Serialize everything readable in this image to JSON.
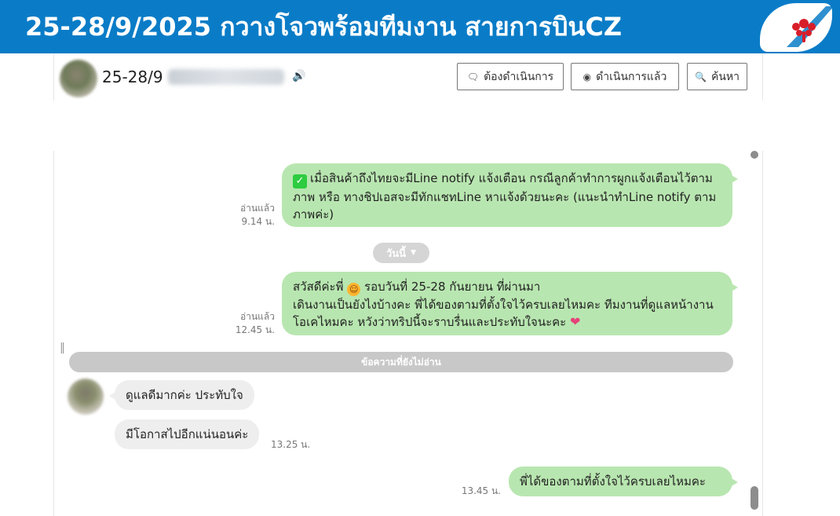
{
  "banner": {
    "title": "25-28/9/2025 กวางโจวพร้อมทีมงาน สายการบินCZ",
    "logo_icon": "airline-logo",
    "colors": {
      "banner_bg": "#0a7cc7",
      "logo_red": "#d81e2a"
    }
  },
  "chat_header": {
    "name_prefix": "25-28/9",
    "speaker_icon": "speaker-icon",
    "buttons": {
      "todo_label": "ต้องดำเนินการ",
      "done_label": "ดำเนินการแล้ว",
      "search_label": "ค้นหา"
    }
  },
  "messages": {
    "m1": {
      "text": "เมื่อสินค้าถึงไทยจะมีLine notify แจ้งเตือน กรณีลูกค้าทำการผูกแจ้งเตือนไว้ตามภาพ หรือ ทางชิปเอสจะมีทักแชทLine หาแจ้งด้วยนะคะ (แนะนำทำLine notify ตามภาพค่ะ)",
      "read": "อ่านแล้ว",
      "time": "9.14 น."
    },
    "date_divider": "วันนี้",
    "m2": {
      "line1": "สวัสดีค่ะพี่",
      "line1b": "รอบวันที่ 25-28 กันยายน ที่ผ่านมา",
      "line2": "เดินงานเป็นยังไงบ้างคะ พี่ได้ของตามที่ตั้งใจไว้ครบเลยไหมคะ ทีมงานที่ดูแลหน้างานโอเคไหมคะ หวังว่าทริปนี้จะราบรื่นและประทับใจนะคะ",
      "read": "อ่านแล้ว",
      "time": "12.45 น."
    },
    "unread_divider": "ข้อความที่ยังไม่อ่าน",
    "in1": {
      "text": "ดูแลดีมากค่ะ ประทับใจ"
    },
    "in2": {
      "text": "มีโอกาสไปอีกแน่นอนค่ะ",
      "time": "13.25 น."
    },
    "m3": {
      "text": "พี่ได้ของตามที่ตั้งใจไว้ครบเลยไหมคะ",
      "time": "13.45 น."
    }
  },
  "colors": {
    "outgoing_bubble": "#b8e6b0",
    "incoming_bubble": "#eeeeee",
    "divider_pill": "#c8c8c8"
  }
}
